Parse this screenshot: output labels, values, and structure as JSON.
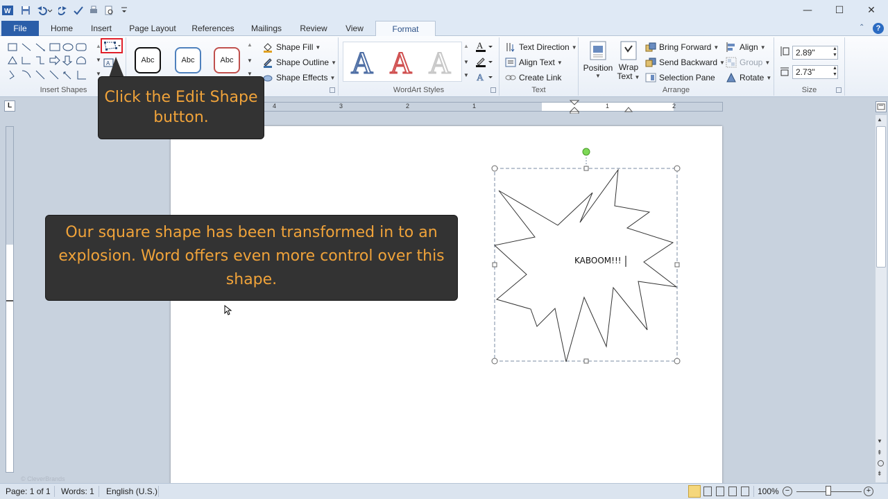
{
  "quick_access": {
    "icons": [
      "word-icon",
      "save-icon",
      "undo-icon",
      "redo-icon",
      "spelling-icon",
      "print-preview-icon",
      "customize-icon"
    ]
  },
  "window_controls": {
    "minimize": "—",
    "restore": "☐",
    "close": "✕"
  },
  "tabs": [
    {
      "label": "File"
    },
    {
      "label": "Home"
    },
    {
      "label": "Insert"
    },
    {
      "label": "Page Layout"
    },
    {
      "label": "References"
    },
    {
      "label": "Mailings"
    },
    {
      "label": "Review"
    },
    {
      "label": "View"
    },
    {
      "label": "Format"
    }
  ],
  "ribbon": {
    "insert_shapes": {
      "label": "Insert Shapes"
    },
    "shape_styles": {
      "thumbs": [
        {
          "text": "Abc",
          "border": "#111111"
        },
        {
          "text": "Abc",
          "border": "#4f81bd"
        },
        {
          "text": "Abc",
          "border": "#c0504d"
        }
      ],
      "shape_fill": "Shape Fill",
      "shape_outline": "Shape Outline",
      "shape_effects": "Shape Effects"
    },
    "wordart": {
      "label": "WordArt Styles",
      "letters": [
        {
          "text": "A",
          "color": "#4f6fa5"
        },
        {
          "text": "A",
          "color": "#d05050"
        },
        {
          "text": "A",
          "color": "#c8c8c8"
        }
      ]
    },
    "text": {
      "label": "Text",
      "text_direction": "Text Direction",
      "align_text": "Align Text",
      "create_link": "Create Link"
    },
    "arrange": {
      "label": "Arrange",
      "position": "Position",
      "wrap_text_1": "Wrap",
      "wrap_text_2": "Text",
      "bring_forward": "Bring Forward",
      "send_backward": "Send Backward",
      "selection_pane": "Selection Pane",
      "align": "Align",
      "group": "Group",
      "rotate": "Rotate"
    },
    "size": {
      "label": "Size",
      "height": "2.89\"",
      "width": "2.73\""
    }
  },
  "ruler": {
    "numbers": [
      "4",
      "3",
      "2",
      "1",
      "1",
      "2"
    ]
  },
  "document": {
    "shape_text": "KABOOM!!!"
  },
  "callouts": {
    "edit_shape": "Click the Edit Shape button.",
    "explosion": "Our square shape has been transformed in to an explosion. Word offers even more control over this shape."
  },
  "watermark": "© CleverBrands",
  "status": {
    "page": "Page: 1 of 1",
    "words": "Words: 1",
    "language": "English (U.S.)",
    "zoom": "100%"
  },
  "colors": {
    "file_tab": "#2b5ea9",
    "callout_bg": "#333333",
    "callout_text": "#f0a33a",
    "highlight_red": "#e0202a",
    "rotate_handle": "#7ed957"
  }
}
